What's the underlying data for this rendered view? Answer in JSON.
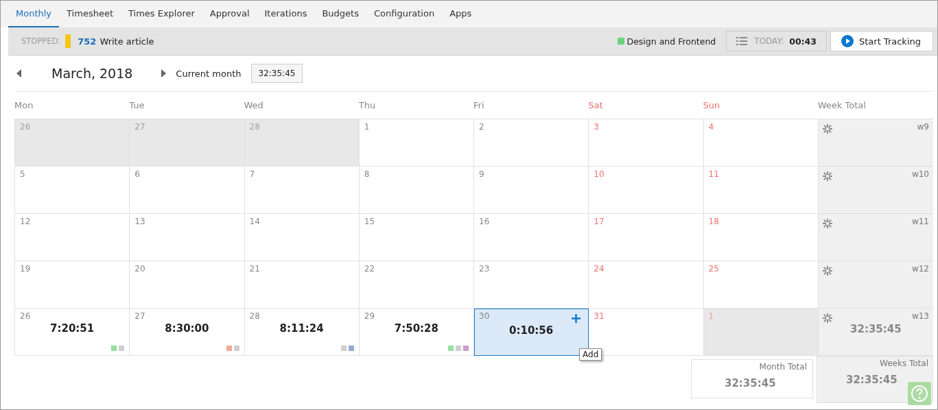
{
  "tabs": [
    {
      "label": "Monthly",
      "selected": true
    },
    {
      "label": "Timesheet",
      "selected": false
    },
    {
      "label": "Times Explorer",
      "selected": false
    },
    {
      "label": "Approval",
      "selected": false
    },
    {
      "label": "Iterations",
      "selected": false
    },
    {
      "label": "Budgets",
      "selected": false
    },
    {
      "label": "Configuration",
      "selected": false
    },
    {
      "label": "Apps",
      "selected": false
    }
  ],
  "status": {
    "state_label": "STOPPED:",
    "task": {
      "color": "#f5c518"
    },
    "task_id": "752",
    "task_name": "Write article",
    "project": {
      "name": "Design and Frontend",
      "color": "#6dd47e"
    },
    "today_label": "TODAY:",
    "today_value": "00:43",
    "start_button": "Start Tracking"
  },
  "nav": {
    "month": "March, 2018",
    "current_month": "Current month",
    "total": "32:35:45"
  },
  "weekdays": [
    {
      "label": "Mon",
      "weekend": false
    },
    {
      "label": "Tue",
      "weekend": false
    },
    {
      "label": "Wed",
      "weekend": false
    },
    {
      "label": "Thu",
      "weekend": false
    },
    {
      "label": "Fri",
      "weekend": false
    },
    {
      "label": "Sat",
      "weekend": true
    },
    {
      "label": "Sun",
      "weekend": true
    }
  ],
  "week_total_heading": "Week Total",
  "weeks": [
    {
      "week": "w9",
      "days": [
        {
          "day": "26",
          "outside": true,
          "selected": false
        },
        {
          "day": "27",
          "outside": true,
          "selected": false
        },
        {
          "day": "28",
          "outside": true,
          "selected": false
        },
        {
          "day": "1",
          "outside": false,
          "selected": false
        },
        {
          "day": "2",
          "outside": false,
          "selected": false
        },
        {
          "day": "3",
          "outside": false,
          "selected": false
        },
        {
          "day": "4",
          "outside": false,
          "selected": false
        }
      ]
    },
    {
      "week": "w10",
      "days": [
        {
          "day": "5",
          "outside": false,
          "selected": false
        },
        {
          "day": "6",
          "outside": false,
          "selected": false
        },
        {
          "day": "7",
          "outside": false,
          "selected": false
        },
        {
          "day": "8",
          "outside": false,
          "selected": false
        },
        {
          "day": "9",
          "outside": false,
          "selected": false
        },
        {
          "day": "10",
          "outside": false,
          "selected": false
        },
        {
          "day": "11",
          "outside": false,
          "selected": false
        }
      ]
    },
    {
      "week": "w11",
      "days": [
        {
          "day": "12",
          "outside": false,
          "selected": false
        },
        {
          "day": "13",
          "outside": false,
          "selected": false
        },
        {
          "day": "14",
          "outside": false,
          "selected": false
        },
        {
          "day": "15",
          "outside": false,
          "selected": false
        },
        {
          "day": "16",
          "outside": false,
          "selected": false
        },
        {
          "day": "17",
          "outside": false,
          "selected": false
        },
        {
          "day": "18",
          "outside": false,
          "selected": false
        }
      ]
    },
    {
      "week": "w12",
      "days": [
        {
          "day": "19",
          "outside": false,
          "selected": false
        },
        {
          "day": "20",
          "outside": false,
          "selected": false
        },
        {
          "day": "21",
          "outside": false,
          "selected": false
        },
        {
          "day": "22",
          "outside": false,
          "selected": false
        },
        {
          "day": "23",
          "outside": false,
          "selected": false
        },
        {
          "day": "24",
          "outside": false,
          "selected": false
        },
        {
          "day": "25",
          "outside": false,
          "selected": false
        }
      ]
    },
    {
      "week": "w13",
      "total": "32:35:45",
      "days": [
        {
          "day": "26",
          "outside": false,
          "selected": false,
          "time": "7:20:51",
          "tags": [
            {
              "color": "#96e0a0"
            },
            {
              "color": "#cfcfcf"
            }
          ]
        },
        {
          "day": "27",
          "outside": false,
          "selected": false,
          "time": "8:30:00",
          "tags": [
            {
              "color": "#f4a89a"
            },
            {
              "color": "#cfcfcf"
            }
          ]
        },
        {
          "day": "28",
          "outside": false,
          "selected": false,
          "time": "8:11:24",
          "tags": [
            {
              "color": "#cfcfcf"
            },
            {
              "color": "#9aa8d4"
            }
          ]
        },
        {
          "day": "29",
          "outside": false,
          "selected": false,
          "time": "7:50:28",
          "tags": [
            {
              "color": "#96e0a0"
            },
            {
              "color": "#cfcfcf"
            },
            {
              "color": "#c8a0d0"
            }
          ]
        },
        {
          "day": "30",
          "outside": false,
          "selected": true,
          "time": "0:10:56",
          "tooltip": "Add"
        },
        {
          "day": "31",
          "outside": false,
          "selected": false
        },
        {
          "day": "1",
          "outside": true,
          "selected": false
        }
      ]
    }
  ],
  "footer": {
    "month_total_label": "Month Total",
    "month_total": "32:35:45",
    "weeks_total_label": "Weeks Total",
    "weeks_total": "32:35:45"
  }
}
